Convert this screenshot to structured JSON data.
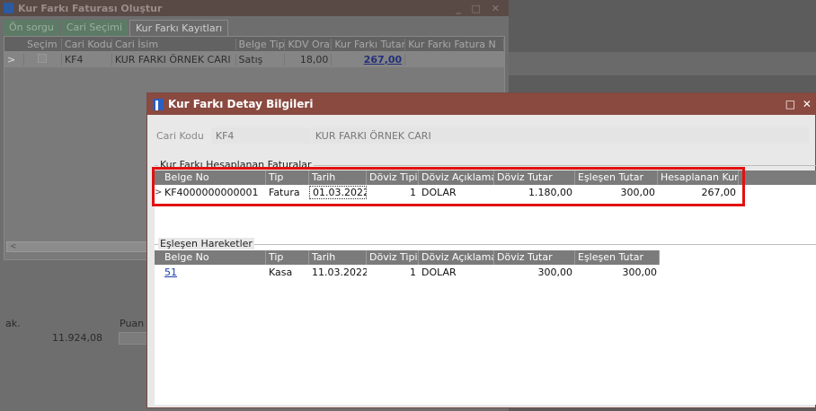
{
  "background_window": {
    "title": "Kur Farkı Faturası Oluştur",
    "window_controls": "_ □ ✕",
    "tabs": [
      "Ön sorgu",
      "Cari Seçimi",
      "Kur Farkı Kayıtları"
    ],
    "grid_headers": [
      "Seçim",
      "Cari Kodu",
      "Cari İsim",
      "Belge Tipi",
      "KDV Oranı",
      "Kur Farkı Tutar",
      "Kur Farkı Fatura N"
    ],
    "grid_row": {
      "indicator": ">",
      "cari_kodu": "KF4",
      "cari_isim": "KUR FARKI ÖRNEK CARI",
      "belge_tipi": "Satış",
      "kdv_orani": "18,00",
      "kur_farki_tutar": "267,00"
    },
    "bottom": {
      "label_left": "ak.",
      "label_puan": "Puan T",
      "total": "11.924,08"
    }
  },
  "dialog": {
    "title": "Kur Farkı Detay Bilgileri",
    "controls": "□ ✕",
    "cari_kodu_label": "Cari Kodu",
    "cari_kodu_value": "KF4",
    "cari_isim_value": "KUR FARKI ÖRNEK CARI",
    "section1": {
      "label": "Kur Farkı Hesaplanan Faturalar",
      "headers": [
        "Belge No",
        "Tip",
        "Tarih",
        "Döviz Tipi",
        "Döviz Açıklama",
        "Döviz Tutar",
        "Eşleşen Tutar",
        "Hesaplanan Kur"
      ],
      "rows": [
        {
          "indicator": ">",
          "belge_no": "KF4000000000001",
          "tip": "Fatura",
          "tarih": "01.03.2022",
          "doviz_tipi": "1",
          "doviz_aciklama": "DOLAR",
          "doviz_tutar": "1.180,00",
          "eslesen_tutar": "300,00",
          "hesaplanan_kur": "267,00"
        }
      ]
    },
    "section2": {
      "label": "Eşleşen Hareketler",
      "headers": [
        "Belge No",
        "Tip",
        "Tarih",
        "Döviz Tipi",
        "Döviz Açıklama",
        "Döviz Tutar",
        "Eşleşen Tutar"
      ],
      "rows": [
        {
          "belge_no": "51",
          "tip": "Kasa",
          "tarih": "11.03.2022",
          "doviz_tipi": "1",
          "doviz_aciklama": "DOLAR",
          "doviz_tutar": "300,00",
          "eslesen_tutar": "300,00"
        }
      ]
    }
  },
  "colors": {
    "dialog_title_bg": "#8a4a40",
    "grid_header_bg": "#7b7b7b",
    "highlight_border": "#e21010",
    "link": "#1d3fa8"
  }
}
